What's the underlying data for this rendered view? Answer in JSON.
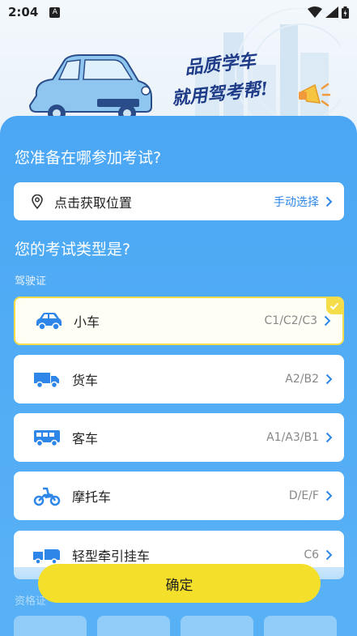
{
  "status_bar": {
    "time": "2:04",
    "notification_badge": "A"
  },
  "hero": {
    "slogan_line1": "品质学车",
    "slogan_line2": "就用驾考帮!"
  },
  "location_question": "您准备在哪参加考试?",
  "location": {
    "placeholder": "点击获取位置",
    "manual_label": "手动选择"
  },
  "exam_type_question": "您的考试类型是?",
  "license_section": "驾驶证",
  "exam_types": [
    {
      "name": "小车",
      "codes": "C1/C2/C3",
      "icon": "car-icon",
      "selected": true
    },
    {
      "name": "货车",
      "codes": "A2/B2",
      "icon": "truck-icon",
      "selected": false
    },
    {
      "name": "客车",
      "codes": "A1/A3/B1",
      "icon": "bus-icon",
      "selected": false
    },
    {
      "name": "摩托车",
      "codes": "D/E/F",
      "icon": "motorcycle-icon",
      "selected": false
    },
    {
      "name": "轻型牵引挂车",
      "codes": "C6",
      "icon": "trailer-icon",
      "selected": false
    }
  ],
  "qualification_section": "资格证",
  "confirm_label": "确定",
  "colors": {
    "panel_blue": "#4ba7f4",
    "accent_yellow": "#f4e02a",
    "icon_blue": "#2e86e8"
  }
}
